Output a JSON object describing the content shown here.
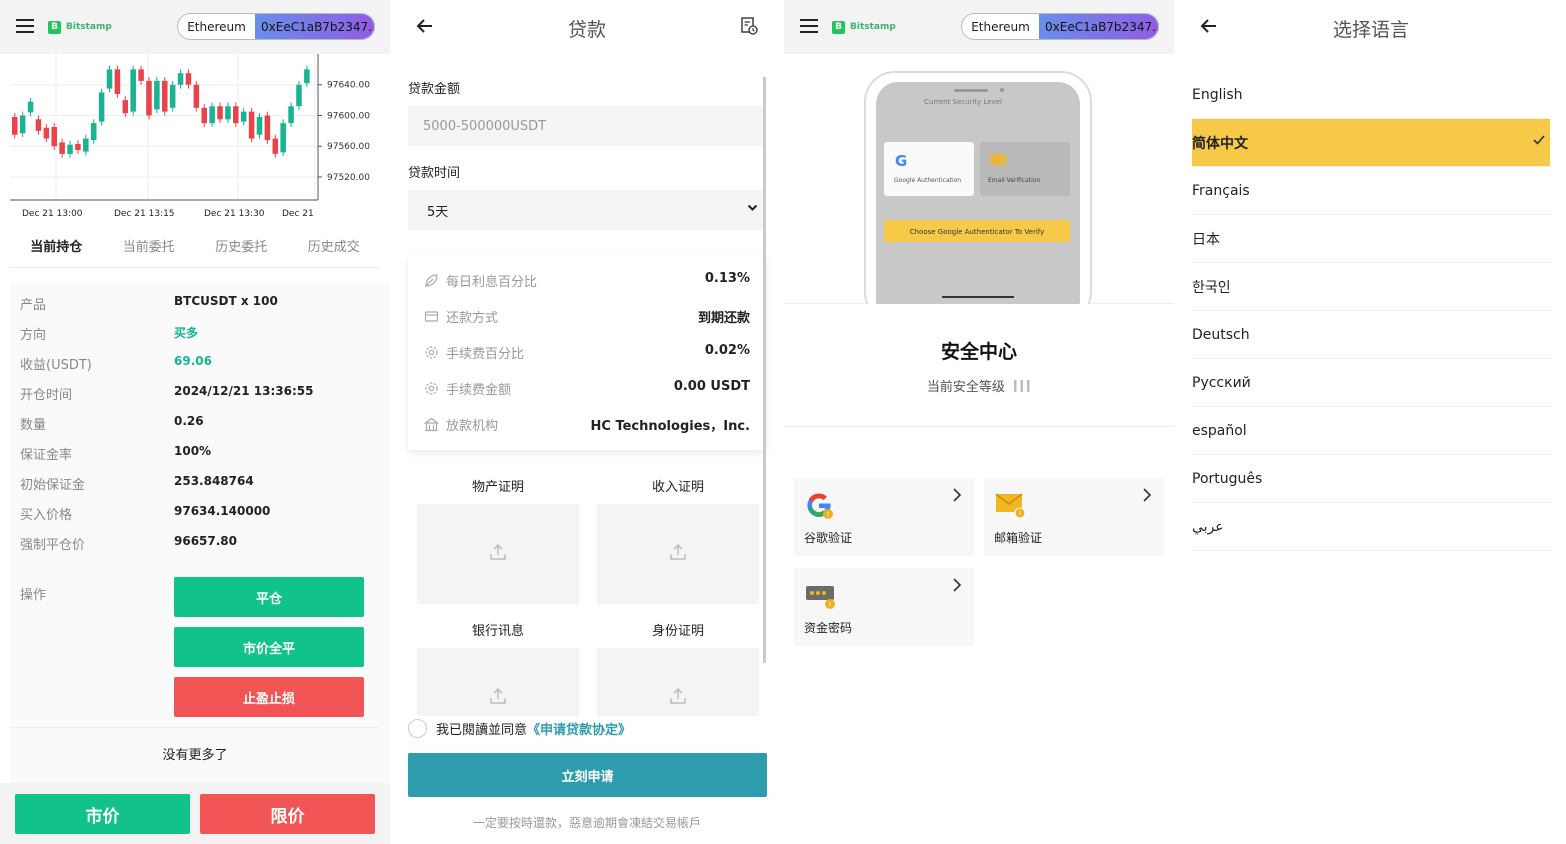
{
  "header": {
    "logo_text": "Bitstamp",
    "logo_mark": "B",
    "chain": "Ethereum",
    "address": "0xEeC1aB7b2347..."
  },
  "chart_data": {
    "type": "candlestick",
    "y_ticks": [
      "97640.00",
      "97600.00",
      "97560.00",
      "97520.00"
    ],
    "x_ticks": [
      "Dec 21 13:00",
      "Dec 21 13:15",
      "Dec 21 13:30",
      "Dec 21"
    ],
    "ylim": [
      97490,
      97680
    ],
    "candles": [
      {
        "o": 97598,
        "c": 97575
      },
      {
        "o": 97577,
        "c": 97600
      },
      {
        "o": 97604,
        "c": 97618
      },
      {
        "o": 97595,
        "c": 97580
      },
      {
        "o": 97584,
        "c": 97570
      },
      {
        "o": 97585,
        "c": 97560
      },
      {
        "o": 97565,
        "c": 97550
      },
      {
        "o": 97550,
        "c": 97562
      },
      {
        "o": 97563,
        "c": 97555
      },
      {
        "o": 97553,
        "c": 97570
      },
      {
        "o": 97568,
        "c": 97590
      },
      {
        "o": 97592,
        "c": 97630
      },
      {
        "o": 97635,
        "c": 97660
      },
      {
        "o": 97660,
        "c": 97628
      },
      {
        "o": 97620,
        "c": 97603
      },
      {
        "o": 97605,
        "c": 97660
      },
      {
        "o": 97660,
        "c": 97645
      },
      {
        "o": 97645,
        "c": 97600
      },
      {
        "o": 97608,
        "c": 97645
      },
      {
        "o": 97645,
        "c": 97605
      },
      {
        "o": 97610,
        "c": 97640
      },
      {
        "o": 97640,
        "c": 97655
      },
      {
        "o": 97655,
        "c": 97640
      },
      {
        "o": 97640,
        "c": 97610
      },
      {
        "o": 97610,
        "c": 97590
      },
      {
        "o": 97590,
        "c": 97612
      },
      {
        "o": 97612,
        "c": 97595
      },
      {
        "o": 97595,
        "c": 97612
      },
      {
        "o": 97612,
        "c": 97590
      },
      {
        "o": 97592,
        "c": 97605
      },
      {
        "o": 97605,
        "c": 97570
      },
      {
        "o": 97575,
        "c": 97598
      },
      {
        "o": 97600,
        "c": 97568
      },
      {
        "o": 97570,
        "c": 97550
      },
      {
        "o": 97552,
        "c": 97590
      },
      {
        "o": 97590,
        "c": 97612
      },
      {
        "o": 97612,
        "c": 97640
      },
      {
        "o": 97642,
        "c": 97660
      }
    ],
    "up_color": "#1ab394",
    "down_color": "#e8444a"
  },
  "p1": {
    "tabs": [
      "当前持仓",
      "当前委托",
      "历史委托",
      "历史成交"
    ],
    "rows": [
      {
        "label": "产品",
        "value": "BTCUSDT x 100",
        "color": "#222222"
      },
      {
        "label": "方向",
        "value": "买多",
        "color": "#1ab394"
      },
      {
        "label": "收益(USDT)",
        "value": "69.06",
        "color": "#1ab394"
      },
      {
        "label": "开仓时间",
        "value": "2024/12/21 13:36:55",
        "color": "#222222"
      },
      {
        "label": "数量",
        "value": "0.26",
        "color": "#222222"
      },
      {
        "label": "保证金率",
        "value": "100%",
        "color": "#222222"
      },
      {
        "label": "初始保证金",
        "value": "253.848764",
        "color": "#222222"
      },
      {
        "label": "买入价格",
        "value": "97634.140000",
        "color": "#222222"
      },
      {
        "label": "强制平仓价",
        "value": "96657.80",
        "color": "#222222"
      }
    ],
    "op_label": "操作",
    "btn_close": "平仓",
    "btn_close_all": "市价全平",
    "btn_tpsl": "止盈止损",
    "no_more": "没有更多了",
    "btn_market": "市价",
    "btn_limit": "限价",
    "green": "#11c28a",
    "red": "#f25555"
  },
  "p2": {
    "title": "贷款",
    "amount_label": "贷款金额",
    "amount_placeholder": "5000-500000USDT",
    "time_label": "贷款时间",
    "time_value": "5天",
    "info": [
      {
        "icon": "leaf-icon",
        "label": "每日利息百分比",
        "value": "0.13%"
      },
      {
        "icon": "wallet-icon",
        "label": "还款方式",
        "value": "到期还款"
      },
      {
        "icon": "gear-icon",
        "label": "手续费百分比",
        "value": "0.02%"
      },
      {
        "icon": "gear-icon",
        "label": "手续费金额",
        "value": "0.00 USDT"
      },
      {
        "icon": "bank-icon",
        "label": "放款机构",
        "value": "HC Technologies，Inc."
      }
    ],
    "uploads": [
      "物产证明",
      "收入证明",
      "银行讯息",
      "身份证明"
    ],
    "agree_text": "我已閱讀並同意",
    "agree_link": "《申请贷款协定》",
    "apply": "立刻申请",
    "note": "一定要按時還款，惡意逾期會凍結交易帳戶"
  },
  "p3": {
    "mockup_header": "Current Security Level",
    "mockup_google": "Google Authentication",
    "mockup_email": "Email Verification",
    "mockup_banner": "Choose Google Authenticator To Verify",
    "title": "安全中心",
    "level_label": "当前安全等级",
    "cards": [
      "谷歌验证",
      "邮箱验证",
      "资金密码"
    ]
  },
  "p4": {
    "title": "选择语言",
    "languages": [
      "English",
      "简体中文",
      "Français",
      "日本",
      "한국인",
      "Deutsch",
      "Русский",
      "español",
      "Português",
      "عربي"
    ],
    "selected": 1
  }
}
